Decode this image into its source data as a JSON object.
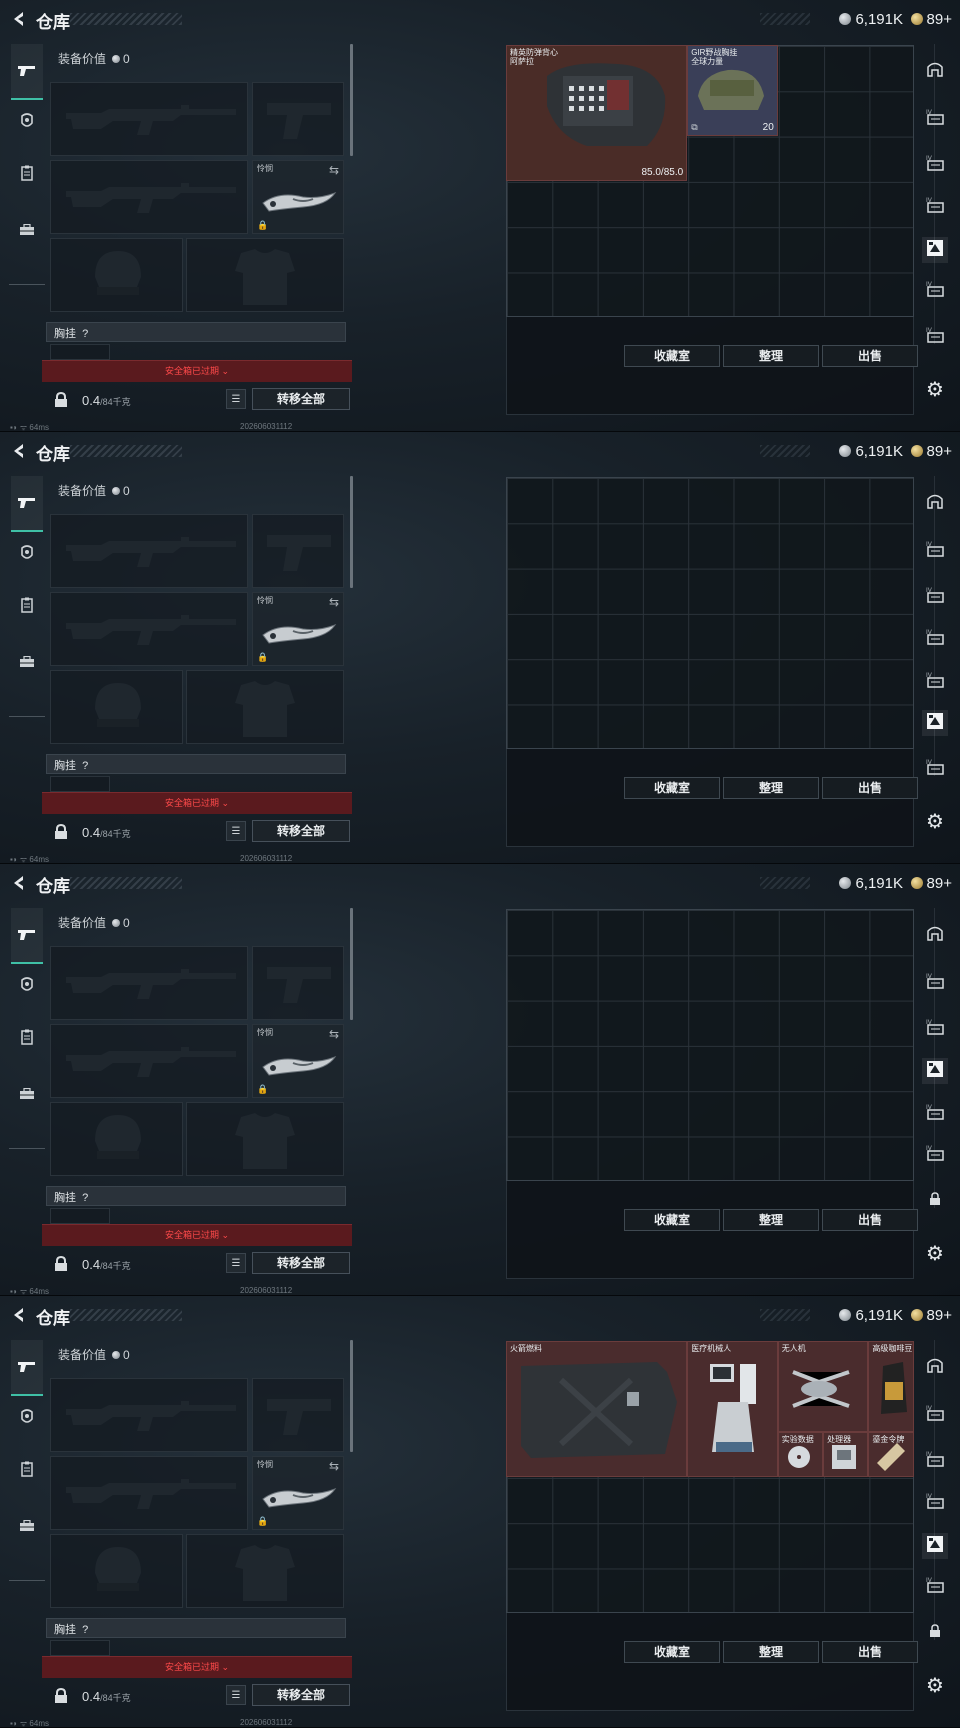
{
  "panels": [
    {
      "title": "仓库",
      "currency": {
        "silver": "6,191K",
        "gold": "89+"
      },
      "equipment_value_label": "装备价值",
      "equipment_value": "0",
      "melee_label": "怜悯",
      "chest_rig_label": "胸挂",
      "chest_rig_value": "?",
      "safe_box_text": "安全箱已过期",
      "weight_value": "0.4",
      "weight_capacity": "/84千克",
      "transfer_all_label": "转移全部",
      "ping": "64ms",
      "timestamp": "202606031112",
      "buttons": {
        "collection": "收藏室",
        "sort": "整理",
        "sell": "出售"
      },
      "active_right_tab": 4,
      "right_nav_icons": [
        "armor-tab-icon",
        "tier4-tab-icon",
        "tier4-plus-tab-icon",
        "tier3-tab-icon",
        "active-grid-tab-icon",
        "tier4-grid-tab-icon",
        "tier5-tab-icon"
      ],
      "items": [
        {
          "name": "精英防弹背心\n阿萨拉",
          "value": "85.0/85.0",
          "kind": "vest"
        },
        {
          "name": "GIR野战胸挂\n全球力量",
          "count": "20",
          "kind": "rig"
        }
      ]
    },
    {
      "title": "仓库",
      "currency": {
        "silver": "6,191K",
        "gold": "89+"
      },
      "equipment_value_label": "装备价值",
      "equipment_value": "0",
      "melee_label": "怜悯",
      "chest_rig_label": "胸挂",
      "chest_rig_value": "?",
      "safe_box_text": "安全箱已过期",
      "weight_value": "0.4",
      "weight_capacity": "/84千克",
      "transfer_all_label": "转移全部",
      "ping": "64ms",
      "timestamp": "202606031112",
      "buttons": {
        "collection": "收藏室",
        "sort": "整理",
        "sell": "出售"
      },
      "active_right_tab": 5,
      "right_nav_icons": [
        "armor-tab-icon",
        "tier4-tab-icon",
        "tier4-plus-tab-icon",
        "tier3-tab-icon",
        "tier3-grid-tab-icon",
        "active-grid-tab-icon",
        "tier5-tab-icon"
      ],
      "items": []
    },
    {
      "title": "仓库",
      "currency": {
        "silver": "6,191K",
        "gold": "89+"
      },
      "equipment_value_label": "装备价值",
      "equipment_value": "0",
      "melee_label": "怜悯",
      "chest_rig_label": "胸挂",
      "chest_rig_value": "?",
      "safe_box_text": "安全箱已过期",
      "weight_value": "0.4",
      "weight_capacity": "/84千克",
      "transfer_all_label": "转移全部",
      "ping": "64ms",
      "timestamp": "202606031112",
      "buttons": {
        "collection": "收藏室",
        "sort": "整理",
        "sell": "出售"
      },
      "active_right_tab": 3,
      "right_nav_icons": [
        "armor-tab-icon",
        "tier3-tab-icon",
        "tier3-grid-tab-icon",
        "active-grid-tab-icon",
        "tier5-tab-icon",
        "tier4-tab-icon",
        "lock-tab-icon"
      ],
      "items": []
    },
    {
      "title": "仓库",
      "currency": {
        "silver": "6,191K",
        "gold": "89+"
      },
      "equipment_value_label": "装备价值",
      "equipment_value": "0",
      "melee_label": "怜悯",
      "chest_rig_label": "胸挂",
      "chest_rig_value": "?",
      "safe_box_text": "安全箱已过期",
      "weight_value": "0.4",
      "weight_capacity": "/84千克",
      "transfer_all_label": "转移全部",
      "ping": "64ms",
      "timestamp": "202606031112",
      "buttons": {
        "collection": "收藏室",
        "sort": "整理",
        "sell": "出售"
      },
      "active_right_tab": 4,
      "right_nav_icons": [
        "armor-tab-icon",
        "tier4-tab-icon",
        "tier4-plus-tab-icon",
        "tier3-tab-icon",
        "active-grid-tab-icon",
        "tier4-grid-tab-icon",
        "lock-tab-icon"
      ],
      "items": [
        {
          "name": "火箭燃料",
          "kind": "fuel"
        },
        {
          "name": "医疗机械人",
          "kind": "robot"
        },
        {
          "name": "无人机",
          "kind": "drone"
        },
        {
          "name": "高级咖啡豆",
          "kind": "coffee"
        },
        {
          "name": "实验数据",
          "kind": "disc"
        },
        {
          "name": "处理器",
          "kind": "cpu"
        },
        {
          "name": "鎏金令牌",
          "kind": "card"
        }
      ]
    }
  ]
}
